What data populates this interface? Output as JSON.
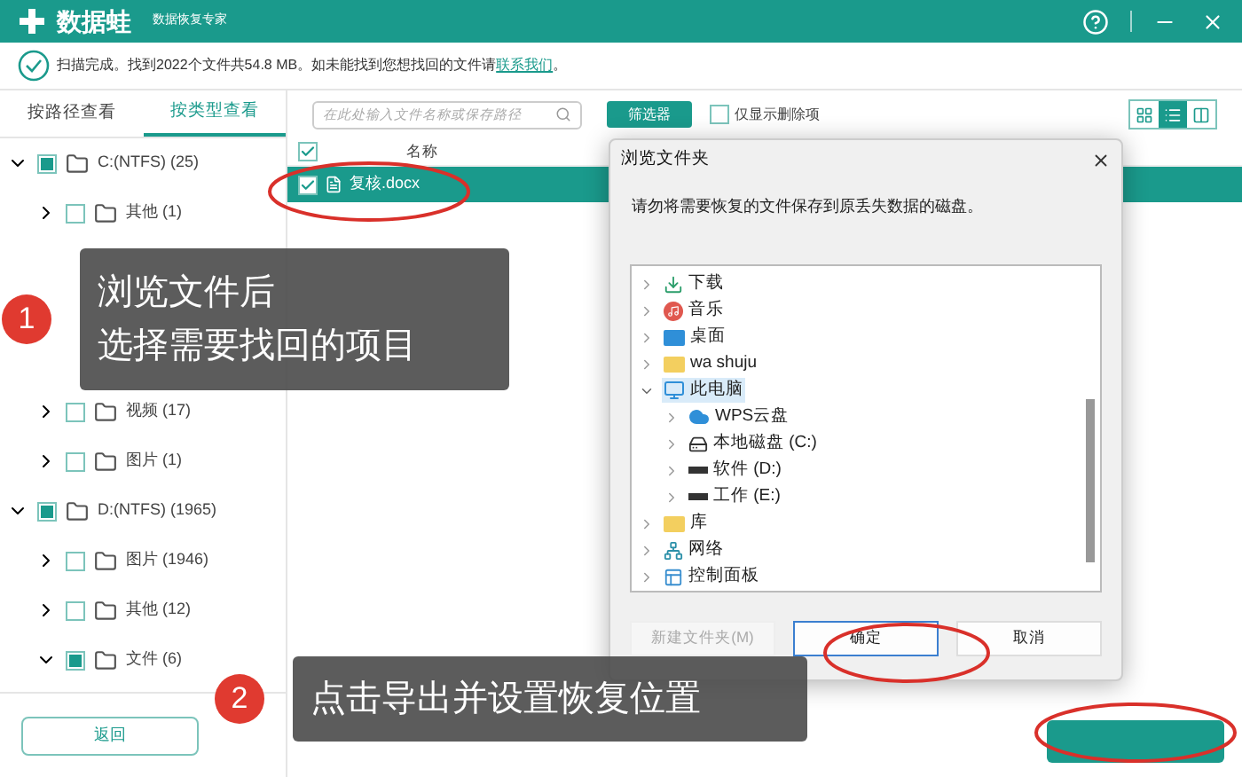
{
  "app": {
    "name": "数据蛙",
    "subtitle": "数据恢复专家"
  },
  "status": {
    "text": "扫描完成。找到2022个文件共54.8 MB。如未能找到您想找回的文件请",
    "link": "联系我们",
    "end": "。"
  },
  "view_tabs": [
    {
      "label": "按路径查看",
      "selected": false
    },
    {
      "label": "按类型查看",
      "selected": true
    }
  ],
  "tree": [
    {
      "label": "C:(NTFS) (25)",
      "partially_checked": true,
      "expanded": true,
      "children": [
        {
          "label": "其他 (1)",
          "partially_checked": false,
          "expanded": false
        },
        {
          "label": "视频 (17)",
          "partially_checked": false,
          "expanded": false
        },
        {
          "label": "图片 (1)",
          "partially_checked": false,
          "expanded": false
        }
      ]
    },
    {
      "label": "D:(NTFS) (1965)",
      "partially_checked": true,
      "expanded": true,
      "children": [
        {
          "label": "图片 (1946)",
          "partially_checked": false,
          "expanded": false
        },
        {
          "label": "其他 (12)",
          "partially_checked": false,
          "expanded": false
        },
        {
          "label": "文件 (6)",
          "partially_checked": true,
          "expanded": true
        }
      ]
    }
  ],
  "search": {
    "placeholder": "在此处输入文件名称或保存路径"
  },
  "filter_button": "筛选器",
  "deleted_only": {
    "label": "仅显示删除项",
    "checked": false
  },
  "view_modes": [
    {
      "kind": "grid",
      "selected": false
    },
    {
      "kind": "list",
      "selected": true
    },
    {
      "kind": "columns",
      "selected": false
    }
  ],
  "file_table": {
    "header_checked": true,
    "column": "名称",
    "rows": [
      {
        "name": "复核.docx",
        "checked": true,
        "selected": true
      }
    ]
  },
  "back_button": "返回",
  "dialog": {
    "title": "浏览文件夹",
    "message": "请勿将需要恢复的文件保存到原丢失数据的磁盘。",
    "folders": [
      {
        "label": "下载",
        "kind": "download",
        "expanded": false,
        "selected": false
      },
      {
        "label": "音乐",
        "kind": "music",
        "expanded": false,
        "selected": false
      },
      {
        "label": "桌面",
        "kind": "desktop",
        "expanded": false,
        "selected": false
      },
      {
        "label": "wa shuju",
        "kind": "folder",
        "expanded": false,
        "selected": false
      },
      {
        "label": "此电脑",
        "kind": "pc",
        "expanded": true,
        "selected": true,
        "children": [
          {
            "label": "WPS云盘",
            "kind": "cloud",
            "expanded": false,
            "selected": false
          },
          {
            "label": "本地磁盘 (C:)",
            "kind": "system-drive",
            "expanded": false,
            "selected": false
          },
          {
            "label": "软件 (D:)",
            "kind": "drive",
            "expanded": false,
            "selected": false
          },
          {
            "label": "工作 (E:)",
            "kind": "drive",
            "expanded": false,
            "selected": false
          }
        ]
      },
      {
        "label": "库",
        "kind": "folder",
        "expanded": false,
        "selected": false
      },
      {
        "label": "网络",
        "kind": "network",
        "expanded": false,
        "selected": false
      },
      {
        "label": "控制面板",
        "kind": "control-panel",
        "expanded": false,
        "selected": false
      }
    ],
    "buttons": [
      {
        "label": "新建文件夹(M)",
        "disabled": true,
        "default": false
      },
      {
        "label": "确定",
        "disabled": false,
        "default": true
      },
      {
        "label": "取消",
        "disabled": false,
        "default": false
      }
    ]
  },
  "callouts": [
    {
      "number": "1",
      "lines": [
        "浏览文件后",
        "选择需要找回的项目"
      ]
    },
    {
      "number": "2",
      "lines": [
        "点击导出并设置恢复位置"
      ]
    }
  ]
}
